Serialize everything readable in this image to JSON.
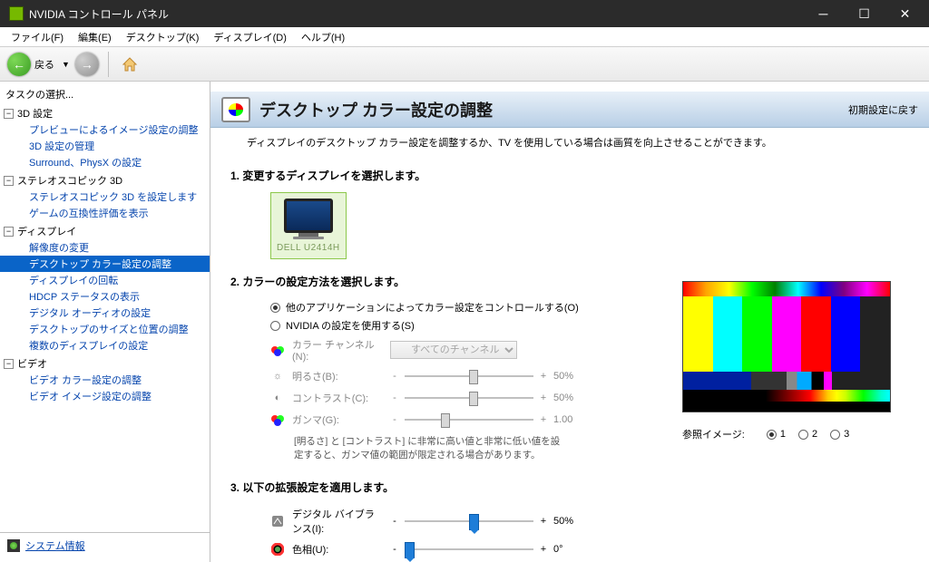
{
  "window": {
    "title": "NVIDIA コントロール パネル"
  },
  "menu": {
    "file": "ファイル(F)",
    "edit": "編集(E)",
    "desktop": "デスクトップ(K)",
    "display": "ディスプレイ(D)",
    "help": "ヘルプ(H)"
  },
  "toolbar": {
    "back": "戻る"
  },
  "sidebar": {
    "header": "タスクの選択...",
    "groups": [
      {
        "label": "3D 設定",
        "items": [
          "プレビューによるイメージ設定の調整",
          "3D 設定の管理",
          "Surround、PhysX の設定"
        ]
      },
      {
        "label": "ステレオスコピック 3D",
        "items": [
          "ステレオスコピック 3D を設定します",
          "ゲームの互換性評価を表示"
        ]
      },
      {
        "label": "ディスプレイ",
        "items": [
          "解像度の変更",
          "デスクトップ カラー設定の調整",
          "ディスプレイの回転",
          "HDCP ステータスの表示",
          "デジタル オーディオの設定",
          "デスクトップのサイズと位置の調整",
          "複数のディスプレイの設定"
        ]
      },
      {
        "label": "ビデオ",
        "items": [
          "ビデオ カラー設定の調整",
          "ビデオ イメージ設定の調整"
        ]
      }
    ],
    "selected": "デスクトップ カラー設定の調整",
    "sysinfo": "システム情報"
  },
  "page": {
    "title": "デスクトップ カラー設定の調整",
    "reset": "初期設定に戻す",
    "desc": "ディスプレイのデスクトップ カラー設定を調整するか、TV を使用している場合は画質を向上させることができます。",
    "s1": {
      "h": "1. 変更するディスプレイを選択します。",
      "mon": "DELL U2414H"
    },
    "s2": {
      "h": "2. カラーの設定方法を選択します。",
      "r1": "他のアプリケーションによってカラー設定をコントロールする(O)",
      "r2": "NVIDIA の設定を使用する(S)",
      "channel_lbl": "カラー チャンネル(N):",
      "channel_val": "すべてのチャンネル",
      "bright_lbl": "明るさ(B):",
      "bright_val": "50%",
      "contrast_lbl": "コントラスト(C):",
      "contrast_val": "50%",
      "gamma_lbl": "ガンマ(G):",
      "gamma_val": "1.00",
      "note": "[明るさ] と [コントラスト] に非常に高い値と非常に低い値を設定すると、ガンマ値の範囲が限定される場合があります。"
    },
    "s3": {
      "h": "3. 以下の拡張設定を適用します。",
      "vib_lbl": "デジタル バイブランス(I):",
      "vib_val": "50%",
      "hue_lbl": "色相(U):",
      "hue_val": "0°"
    },
    "preview": {
      "ref_lbl": "参照イメージ:",
      "opts": [
        "1",
        "2",
        "3"
      ]
    }
  }
}
